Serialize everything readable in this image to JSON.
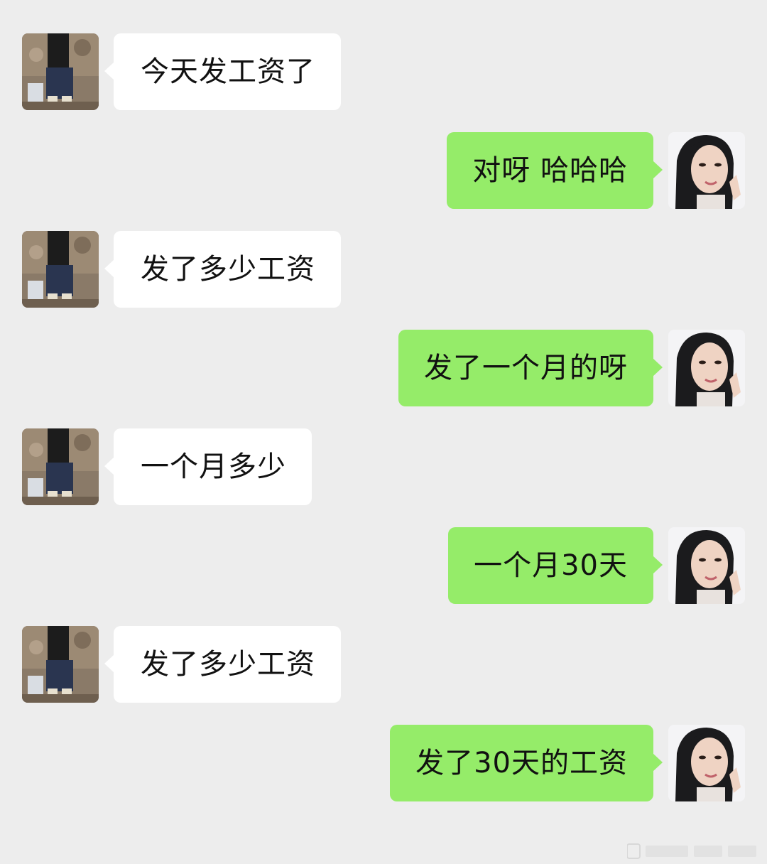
{
  "messages": [
    {
      "side": "left",
      "text": "今天发工资了"
    },
    {
      "side": "right",
      "text": "对呀 哈哈哈"
    },
    {
      "side": "left",
      "text": "发了多少工资"
    },
    {
      "side": "right",
      "text": "发了一个月的呀"
    },
    {
      "side": "left",
      "text": "一个月多少"
    },
    {
      "side": "right",
      "text": "一个月30天"
    },
    {
      "side": "left",
      "text": "发了多少工资"
    },
    {
      "side": "right",
      "text": "发了30天的工资"
    }
  ],
  "colors": {
    "background": "#ededed",
    "incoming_bubble": "#ffffff",
    "outgoing_bubble": "#95ec69",
    "text": "#111111"
  },
  "icons": {
    "incoming_avatar": "contact-avatar-icon",
    "outgoing_avatar": "self-avatar-icon"
  }
}
